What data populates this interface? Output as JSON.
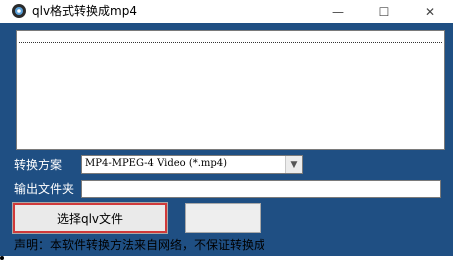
{
  "window": {
    "title": "qlv格式转换成mp4",
    "minimize_glyph": "—",
    "maximize_glyph": "☐",
    "close_glyph": "✕"
  },
  "form": {
    "scheme_label": "转换方案",
    "scheme_value": "MP4-MPEG-4 Video (*.mp4)",
    "output_label": "输出文件夹",
    "output_value": ""
  },
  "buttons": {
    "select_label": "选择qlv文件",
    "second_label": ""
  },
  "notice": "声明：本软件转换方法来自网络，不保证转换成",
  "colors": {
    "window_bg": "#1f4f83",
    "highlight_border": "#d03a3a"
  }
}
